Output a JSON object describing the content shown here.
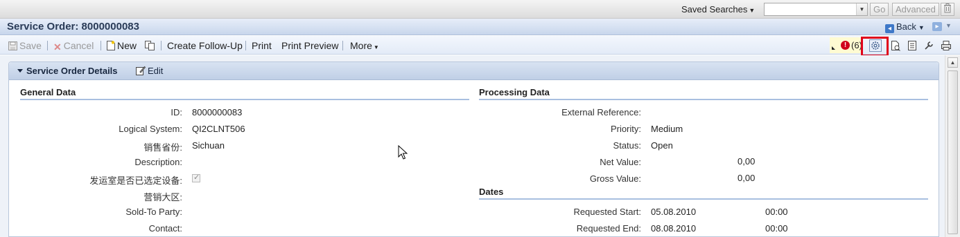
{
  "topbar": {
    "saved_searches_label": "Saved Searches",
    "search_value": "",
    "go_label": "Go",
    "advanced_label": "Advanced"
  },
  "titlebar": {
    "title": "Service Order: 8000000083",
    "back_label": "Back"
  },
  "toolbar": {
    "save_label": "Save",
    "cancel_label": "Cancel",
    "new_label": "New",
    "create_follow_up_label": "Create Follow-Up",
    "print_label": "Print",
    "print_preview_label": "Print Preview",
    "more_label": "More",
    "message_count": "(6)"
  },
  "panel": {
    "title": "Service Order Details",
    "edit_label": "Edit",
    "general": {
      "heading": "General Data",
      "fields": [
        {
          "label": "ID:",
          "value": "8000000083"
        },
        {
          "label": "Logical System:",
          "value": "QI2CLNT506"
        },
        {
          "label": "销售省份:",
          "value": "Sichuan"
        },
        {
          "label": "Description:",
          "value": ""
        },
        {
          "label": "发运室是否已选定设备:",
          "value": ""
        },
        {
          "label": "营销大区:",
          "value": ""
        },
        {
          "label": "Sold-To Party:",
          "value": ""
        },
        {
          "label": "Contact:",
          "value": ""
        }
      ],
      "equipment_selected_checked": true
    },
    "processing": {
      "heading": "Processing Data",
      "fields": [
        {
          "label": "External Reference:",
          "value": ""
        },
        {
          "label": "Priority:",
          "value": "Medium"
        },
        {
          "label": "Status:",
          "value": "Open"
        },
        {
          "label": "Net Value:",
          "value": "0,00"
        },
        {
          "label": "Gross Value:",
          "value": "0,00"
        }
      ]
    },
    "dates": {
      "heading": "Dates",
      "fields": [
        {
          "label": "Requested Start:",
          "date": "05.08.2010",
          "time": "00:00"
        },
        {
          "label": "Requested End:",
          "date": "08.08.2010",
          "time": "00:00"
        }
      ]
    }
  },
  "colors": {
    "accent": "#2a3b57",
    "highlight": "#e0001a",
    "error": "#d0021b"
  }
}
